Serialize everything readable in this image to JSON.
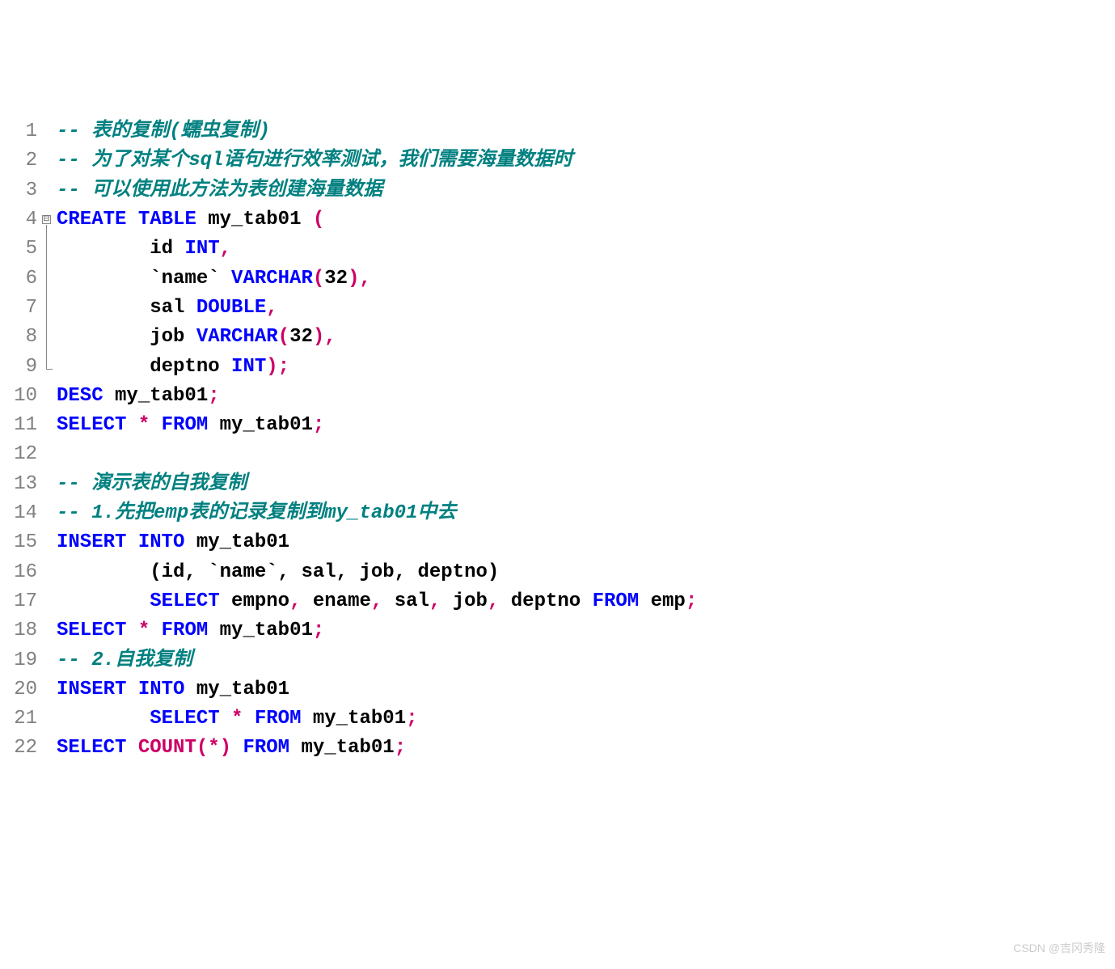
{
  "lines": [
    {
      "n": "1"
    },
    {
      "n": "2"
    },
    {
      "n": "3"
    },
    {
      "n": "4"
    },
    {
      "n": "5"
    },
    {
      "n": "6"
    },
    {
      "n": "7"
    },
    {
      "n": "8"
    },
    {
      "n": "9"
    },
    {
      "n": "10"
    },
    {
      "n": "11"
    },
    {
      "n": "12"
    },
    {
      "n": "13"
    },
    {
      "n": "14"
    },
    {
      "n": "15"
    },
    {
      "n": "16"
    },
    {
      "n": "17"
    },
    {
      "n": "18"
    },
    {
      "n": "19"
    },
    {
      "n": "20"
    },
    {
      "n": "21"
    },
    {
      "n": "22"
    }
  ],
  "t": {
    "c1": "-- 表的复制(蠕虫复制)",
    "c2": "-- 为了对某个sql语句进行效率测试，我们需要海量数据时",
    "c3": "-- 可以使用此方法为表创建海量数据",
    "k_create": "CREATE",
    "k_table": "TABLE",
    "tab01": "my_tab01",
    "lp": "(",
    "rp": ")",
    "id": "id",
    "int": "INT",
    "comma": ",",
    "bname": "`name`",
    "varchar": "VARCHAR",
    "n32": "32",
    "sal": "sal",
    "double": "DOUBLE",
    "job": "job",
    "deptno": "deptno",
    "semi": ";",
    "desc": "DESC",
    "select": "SELECT",
    "star": "*",
    "from": "FROM",
    "c13": "-- 演示表的自我复制",
    "c14": "-- 1.先把emp表的记录复制到my_tab01中去",
    "insert": "INSERT",
    "into": "INTO",
    "cols": "(id, `name`, sal, job, deptno)",
    "empno": "empno",
    "ename": "ename",
    "emp": "emp",
    "c19": "-- 2.自我复制",
    "count": "COUNT",
    "fstar": "(*)"
  },
  "watermark": "CSDN @吉冈秀隆",
  "fold": "⊟"
}
